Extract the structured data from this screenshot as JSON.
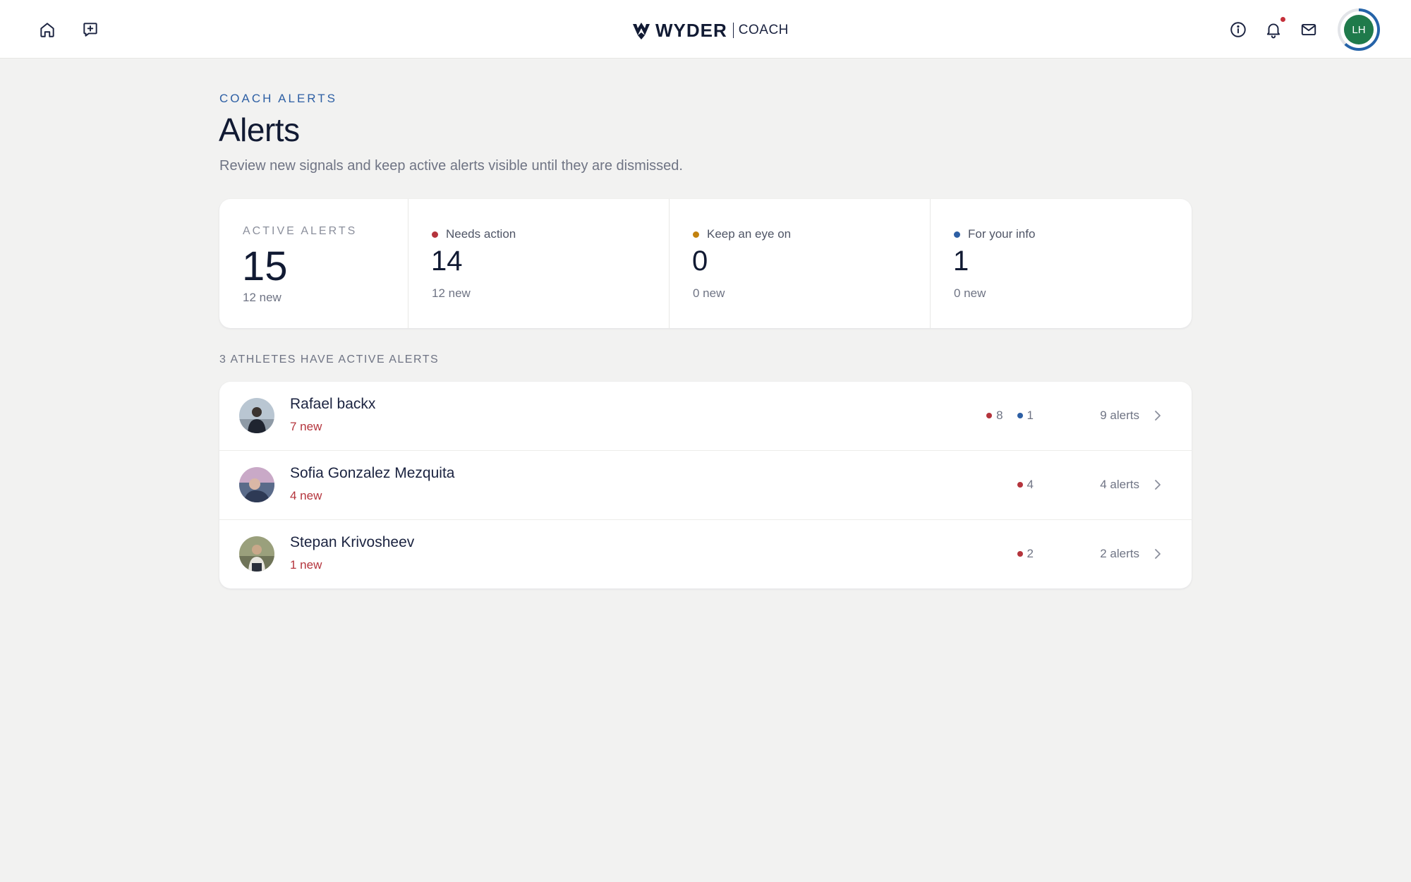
{
  "topbar": {
    "logo_word": "WYDER",
    "logo_sub": "COACH",
    "avatar_initials": "LH",
    "icons": [
      "home-icon",
      "new-message-icon",
      "info-icon",
      "bell-icon",
      "mail-icon"
    ],
    "has_unread_notification": true
  },
  "header": {
    "eyebrow": "COACH ALERTS",
    "title": "Alerts",
    "subtitle": "Review new signals and keep active alerts visible until they are dismissed."
  },
  "summary": {
    "total": {
      "label": "ACTIVE ALERTS",
      "value": "15",
      "new": "12 new"
    },
    "categories": [
      {
        "label": "Needs action",
        "value": "14",
        "new": "12 new",
        "color": "#b4343c"
      },
      {
        "label": "Keep an eye on",
        "value": "0",
        "new": "0 new",
        "color": "#c2820f"
      },
      {
        "label": "For your info",
        "value": "1",
        "new": "0 new",
        "color": "#2d5fa4"
      }
    ]
  },
  "athletes": {
    "section_label": "3 ATHLETES HAVE ACTIVE ALERTS",
    "rows": [
      {
        "name": "Rafael backx",
        "new": "7 new",
        "red_count": "8",
        "blue_count": "1",
        "total": "9 alerts"
      },
      {
        "name": "Sofia Gonzalez Mezquita",
        "new": "4 new",
        "red_count": "4",
        "total": "4 alerts"
      },
      {
        "name": "Stepan Krivosheev",
        "new": "1 new",
        "red_count": "2",
        "total": "2 alerts"
      }
    ]
  },
  "colors": {
    "needs_action": "#b4343c",
    "keep_eye": "#c2820f",
    "info": "#2d5fa4",
    "avatar_bg": "#1f7a4b"
  }
}
